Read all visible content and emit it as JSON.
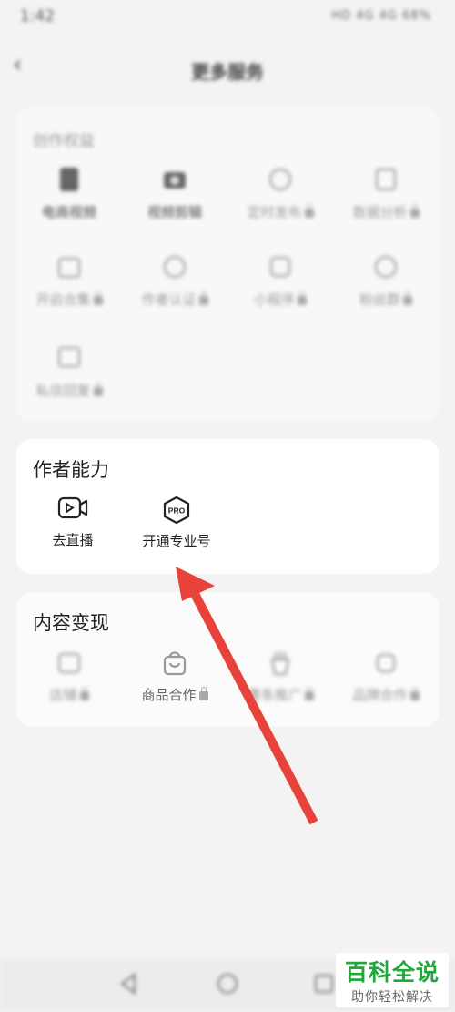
{
  "status_bar": {
    "time": "1:42",
    "indicators": "HD 4G 4G 68%"
  },
  "navbar": {
    "title": "更多服务"
  },
  "basic_features": {
    "title": "创作权益",
    "items": [
      {
        "label": "电商视频",
        "locked": false
      },
      {
        "label": "视频剪辑",
        "locked": false
      },
      {
        "label": "定时发布",
        "locked": true
      },
      {
        "label": "数据分析",
        "locked": true
      },
      {
        "label": "开启合集",
        "locked": true
      },
      {
        "label": "作者认证",
        "locked": true
      },
      {
        "label": "小程序",
        "locked": true
      },
      {
        "label": "粉丝群",
        "locked": true
      },
      {
        "label": "私信回复",
        "locked": true
      }
    ]
  },
  "author_ability": {
    "title": "作者能力",
    "items": [
      {
        "label": "去直播"
      },
      {
        "label": "开通专业号"
      }
    ]
  },
  "monetization": {
    "title": "内容变现",
    "items": [
      {
        "label": "店铺",
        "locked": true
      },
      {
        "label": "商品合作",
        "locked": true
      },
      {
        "label": "薯条推广",
        "locked": true
      },
      {
        "label": "品牌合作",
        "locked": true
      }
    ]
  },
  "watermark": {
    "main": "百科全说",
    "sub": "助你轻松解决"
  },
  "colors": {
    "arrow": "#e8433a",
    "watermark_green": "#1fa83a"
  }
}
